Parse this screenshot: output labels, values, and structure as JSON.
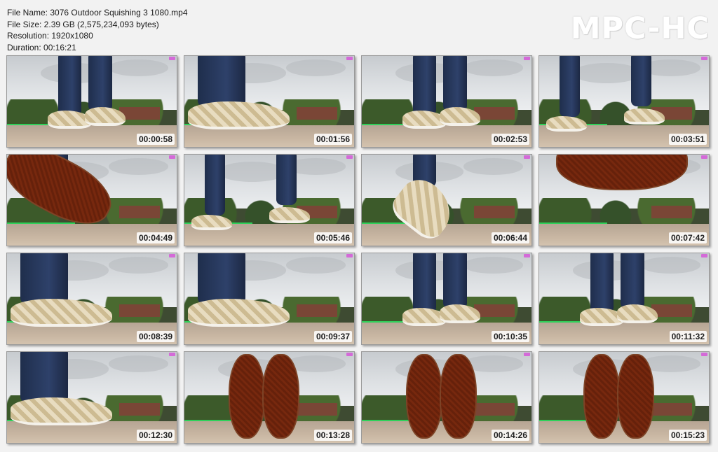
{
  "info": {
    "file_name": "File Name: 3076 Outdoor Squishing 3 1080.mp4",
    "file_size": "File Size: 2.39 GB (2,575,234,093 bytes)",
    "resolution": "Resolution: 1920x1080",
    "duration": "Duration: 00:16:21"
  },
  "logo": "MPC-HC",
  "thumbnails": [
    {
      "time": "00:00:58",
      "scene": "legs-standing"
    },
    {
      "time": "00:01:56",
      "scene": "shoe-side"
    },
    {
      "time": "00:02:53",
      "scene": "legs-standing"
    },
    {
      "time": "00:03:51",
      "scene": "legs-walking"
    },
    {
      "time": "00:04:49",
      "scene": "sole-left"
    },
    {
      "time": "00:05:46",
      "scene": "legs-walking"
    },
    {
      "time": "00:06:44",
      "scene": "shoe-tilted"
    },
    {
      "time": "00:07:42",
      "scene": "sole-top"
    },
    {
      "time": "00:08:39",
      "scene": "shoe-side"
    },
    {
      "time": "00:09:37",
      "scene": "shoe-side"
    },
    {
      "time": "00:10:35",
      "scene": "legs-standing"
    },
    {
      "time": "00:11:32",
      "scene": "legs-standing"
    },
    {
      "time": "00:12:30",
      "scene": "shoe-side"
    },
    {
      "time": "00:13:28",
      "scene": "soles-pair"
    },
    {
      "time": "00:14:26",
      "scene": "soles-pair"
    },
    {
      "time": "00:15:23",
      "scene": "soles-pair"
    }
  ]
}
